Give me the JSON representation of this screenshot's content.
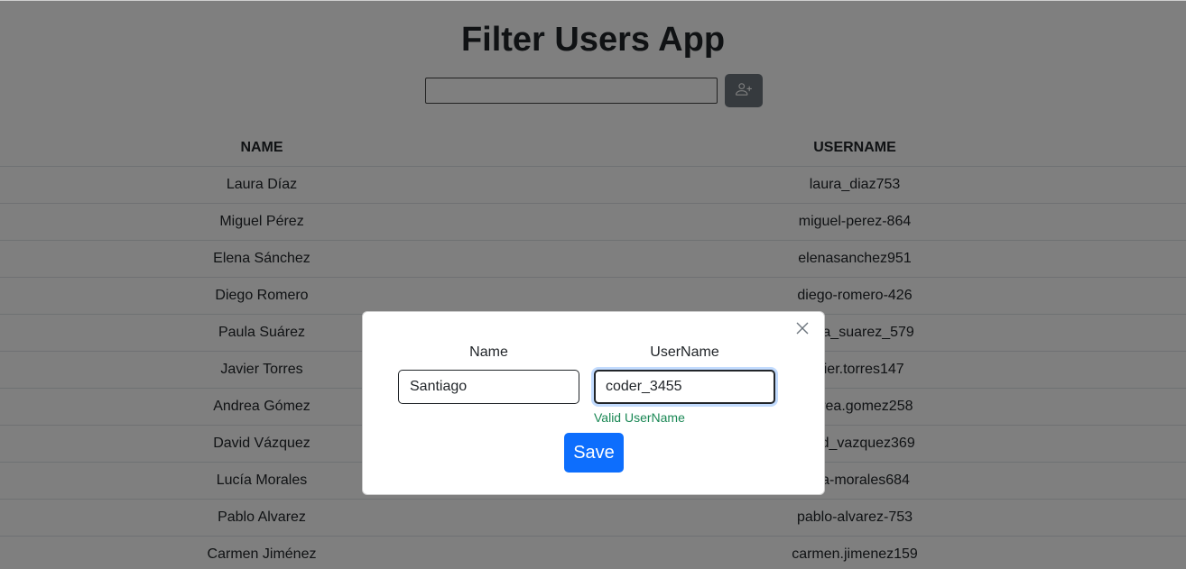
{
  "app": {
    "title": "Filter Users App"
  },
  "search": {
    "value": "",
    "placeholder": ""
  },
  "add_button": {
    "icon": "person-plus-icon"
  },
  "table": {
    "headers": [
      "NAME",
      "USERNAME"
    ],
    "rows": [
      {
        "name": "Laura Díaz",
        "username": "laura_diaz753"
      },
      {
        "name": "Miguel Pérez",
        "username": "miguel-perez-864"
      },
      {
        "name": "Elena Sánchez",
        "username": "elenasanchez951"
      },
      {
        "name": "Diego Romero",
        "username": "diego-romero-426"
      },
      {
        "name": "Paula Suárez",
        "username": "paula_suarez_579"
      },
      {
        "name": "Javier Torres",
        "username": "javier.torres147"
      },
      {
        "name": "Andrea Gómez",
        "username": "andrea.gomez258"
      },
      {
        "name": "David Vázquez",
        "username": "david_vazquez369"
      },
      {
        "name": "Lucía Morales",
        "username": "lucia-morales684"
      },
      {
        "name": "Pablo Alvarez",
        "username": "pablo-alvarez-753"
      },
      {
        "name": "Carmen Jiménez",
        "username": "carmen.jimenez159"
      }
    ]
  },
  "modal": {
    "name_label": "Name",
    "username_label": "UserName",
    "name_value": "Santiago",
    "username_value": "coder_3455",
    "validation_message": "Valid UserName",
    "save_label": "Save",
    "close_icon": "close-icon"
  },
  "colors": {
    "primary": "#0d6efd",
    "secondary": "#6c757d",
    "valid": "#198754",
    "text": "#212529"
  }
}
